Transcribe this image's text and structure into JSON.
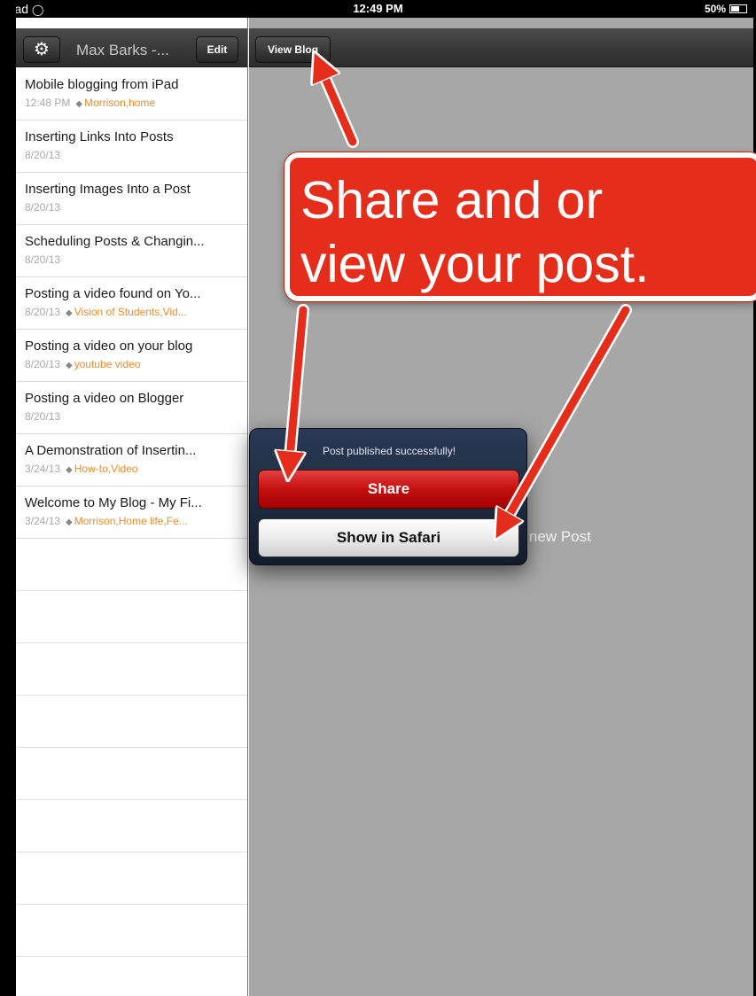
{
  "status_bar": {
    "device": "iPad",
    "wifi_icon": "wifi-icon",
    "time": "12:49 PM",
    "battery": "50%",
    "battery_level": 0.5
  },
  "sidebar": {
    "gear_icon": "gear-icon",
    "blog_title": "Max Barks -...",
    "edit_label": "Edit",
    "posts": [
      {
        "title": "Mobile blogging from iPad",
        "date": "12:48 PM",
        "tags": "Morrison,home"
      },
      {
        "title": "Inserting Links Into Posts",
        "date": "8/20/13",
        "tags": ""
      },
      {
        "title": "Inserting Images Into a Post",
        "date": "8/20/13",
        "tags": ""
      },
      {
        "title": "Scheduling Posts & Changin...",
        "date": "8/20/13",
        "tags": ""
      },
      {
        "title": "Posting a video found on Yo...",
        "date": "8/20/13",
        "tags": "Vision of Students,Vid..."
      },
      {
        "title": "Posting a video on your blog",
        "date": "8/20/13",
        "tags": "youtube video"
      },
      {
        "title": "Posting a video on Blogger",
        "date": "8/20/13",
        "tags": ""
      },
      {
        "title": "A Demonstration of Insertin...",
        "date": "3/24/13",
        "tags": "How-to,Video"
      },
      {
        "title": "Welcome to My Blog - My Fi...",
        "date": "3/24/13",
        "tags": "Morrison,Home life,Fe..."
      }
    ]
  },
  "main": {
    "view_blog_label": "View Blog",
    "placeholder_text": "se new Post"
  },
  "popover": {
    "message": "Post published successfully!",
    "share_label": "Share",
    "safari_label": "Show in Safari"
  },
  "annotation": {
    "callout_text": "Share and or\nview your post.",
    "callout_color": "#e52d1b",
    "arrow_color": "#e52d1b"
  }
}
